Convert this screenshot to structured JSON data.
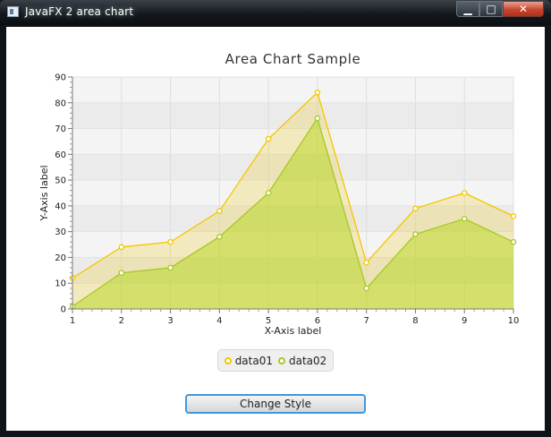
{
  "window": {
    "title": "JavaFX 2 area chart",
    "min_glyph": "▁",
    "max_glyph": "□",
    "close_glyph": "✕"
  },
  "button": {
    "label": "Change Style"
  },
  "chart_data": {
    "type": "area",
    "title": "Area Chart Sample",
    "xlabel": "X-Axis label",
    "ylabel": "Y-Axis label",
    "xlim": [
      1,
      10
    ],
    "ylim": [
      0,
      90
    ],
    "x_ticks": [
      1,
      2,
      3,
      4,
      5,
      6,
      7,
      8,
      9,
      10
    ],
    "y_ticks": [
      0,
      10,
      20,
      30,
      40,
      50,
      60,
      70,
      80,
      90
    ],
    "grid": true,
    "legend_position": "bottom",
    "series": [
      {
        "name": "data01",
        "x": [
          1,
          2,
          3,
          4,
          5,
          6,
          7,
          8,
          9,
          10
        ],
        "values": [
          12,
          24,
          26,
          38,
          66,
          84,
          18,
          39,
          45,
          36
        ],
        "color": "#f3c600"
      },
      {
        "name": "data02",
        "x": [
          1,
          2,
          3,
          4,
          5,
          6,
          7,
          8,
          9,
          10
        ],
        "values": [
          1,
          14,
          16,
          28,
          45,
          74,
          8,
          29,
          35,
          26
        ],
        "color": "#a4c924"
      }
    ]
  }
}
